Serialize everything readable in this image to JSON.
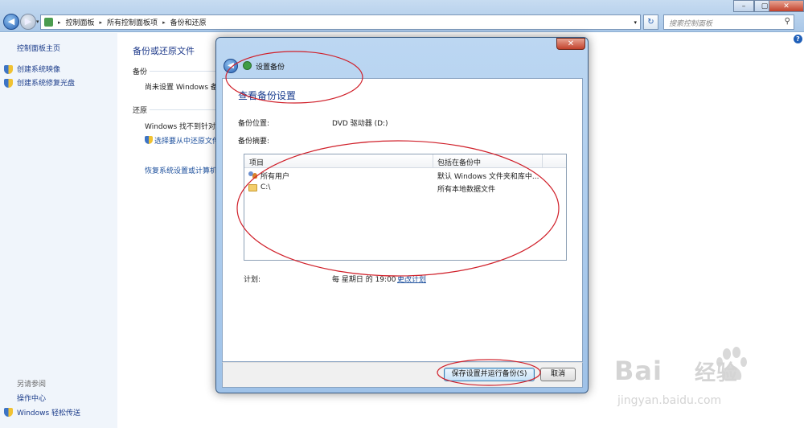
{
  "window": {
    "controls": {
      "minimize": "–",
      "maximize": "▢",
      "close": "✕"
    }
  },
  "address": {
    "crumbs": [
      "控制面板",
      "所有控制面板项",
      "备份和还原"
    ],
    "search_placeholder": "搜索控制面板"
  },
  "sidebar": {
    "home": "控制面板主页",
    "items": [
      {
        "label": "创建系统映像",
        "icon": "shield-icon"
      },
      {
        "label": "创建系统修复光盘",
        "icon": "shield-icon"
      }
    ],
    "see_also": "另请参阅",
    "bottom_items": [
      {
        "label": "操作中心"
      },
      {
        "label": "Windows 轻松传送",
        "icon": "shield-icon"
      }
    ]
  },
  "main": {
    "title": "备份或还原文件",
    "backup_label": "备份",
    "backup_status": "尚未设置 Windows 备",
    "restore_label": "还原",
    "restore_status": "Windows 找不到针对",
    "restore_link": "选择要从中还原文件",
    "recover_link": "恢复系统设置或计算机"
  },
  "dialog": {
    "app_title": "设置备份",
    "heading": "查看备份设置",
    "location_label": "备份位置:",
    "location_value": "DVD 驱动器 (D:)",
    "summary_label": "备份摘要:",
    "columns": [
      "项目",
      "包括在备份中"
    ],
    "rows": [
      {
        "item": "所有用户",
        "included": "默认 Windows 文件夹和库中...",
        "icon": "users-icon"
      },
      {
        "item": "C:\\",
        "included": "所有本地数据文件",
        "icon": "folder-icon"
      }
    ],
    "schedule_label": "计划:",
    "schedule_value": "每 星期日 的 19:00",
    "schedule_link": "更改计划",
    "save_button": "保存设置并运行备份(S)",
    "cancel_button": "取消",
    "close": "✕"
  },
  "watermark": {
    "brand": "Bai",
    "brand_cn": "经验",
    "url": "jingyan.baidu.com"
  },
  "colors": {
    "accent": "#1a3d8f",
    "annotation": "#d0202a",
    "link": "#1c4f9c"
  }
}
